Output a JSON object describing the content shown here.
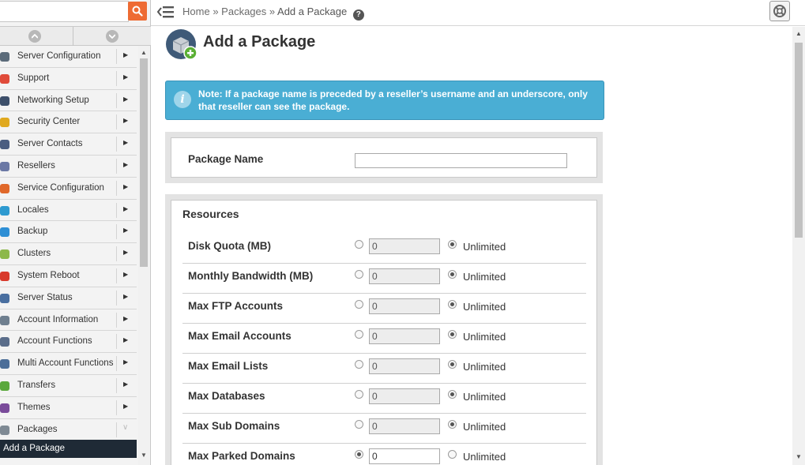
{
  "search": {
    "value": "",
    "placeholder": ""
  },
  "sidebar": {
    "items": [
      {
        "label": "Server Configuration",
        "icon": "server-config-icon",
        "color": "#5b6b7a"
      },
      {
        "label": "Support",
        "icon": "lifebuoy-icon",
        "color": "#e04b3a"
      },
      {
        "label": "Networking Setup",
        "icon": "network-icon",
        "color": "#3d4f6a"
      },
      {
        "label": "Security Center",
        "icon": "lock-icon",
        "color": "#e0a91f"
      },
      {
        "label": "Server Contacts",
        "icon": "contacts-icon",
        "color": "#4a5d80"
      },
      {
        "label": "Resellers",
        "icon": "resellers-icon",
        "color": "#6b78a5"
      },
      {
        "label": "Service Configuration",
        "icon": "wrench-icon",
        "color": "#e0682a"
      },
      {
        "label": "Locales",
        "icon": "globe-icon",
        "color": "#2e9ad0"
      },
      {
        "label": "Backup",
        "icon": "backup-icon",
        "color": "#2e8fd5"
      },
      {
        "label": "Clusters",
        "icon": "clusters-icon",
        "color": "#8db84a"
      },
      {
        "label": "System Reboot",
        "icon": "power-icon",
        "color": "#d83a2c"
      },
      {
        "label": "Server Status",
        "icon": "status-icon",
        "color": "#4a6fa0"
      },
      {
        "label": "Account Information",
        "icon": "account-info-icon",
        "color": "#6f7f8f"
      },
      {
        "label": "Account Functions",
        "icon": "account-functions-icon",
        "color": "#5a6d8a"
      },
      {
        "label": "Multi Account Functions",
        "icon": "multi-account-icon",
        "color": "#4c6e98"
      },
      {
        "label": "Transfers",
        "icon": "transfers-icon",
        "color": "#5aa83c"
      },
      {
        "label": "Themes",
        "icon": "themes-icon",
        "color": "#7a4b9a"
      },
      {
        "label": "Packages",
        "icon": "packages-icon",
        "color": "#7f8a94"
      }
    ],
    "active_item": "Add a Package"
  },
  "breadcrumb": {
    "home": "Home",
    "sep1": "»",
    "packages": "Packages",
    "sep2": "»",
    "current": "Add a Package",
    "help": "?"
  },
  "page": {
    "title": "Add a Package"
  },
  "note": {
    "text": "Note: If a package name is preceded by a reseller’s username and an underscore, only that reseller can see the package."
  },
  "package": {
    "label": "Package Name",
    "value": ""
  },
  "resources": {
    "title": "Resources",
    "unlimited_label": "Unlimited",
    "rows": [
      {
        "label": "Disk Quota (MB)",
        "value": "0",
        "unlimited": true
      },
      {
        "label": "Monthly Bandwidth (MB)",
        "value": "0",
        "unlimited": true
      },
      {
        "label": "Max FTP Accounts",
        "value": "0",
        "unlimited": true
      },
      {
        "label": "Max Email Accounts",
        "value": "0",
        "unlimited": true
      },
      {
        "label": "Max Email Lists",
        "value": "0",
        "unlimited": true
      },
      {
        "label": "Max Databases",
        "value": "0",
        "unlimited": true
      },
      {
        "label": "Max Sub Domains",
        "value": "0",
        "unlimited": true
      },
      {
        "label": "Max Parked Domains",
        "value": "0",
        "unlimited": false
      }
    ]
  },
  "colors": {
    "accent": "#ee6b33",
    "note_bg": "#4aaed4",
    "active_nav": "#1f2a36"
  }
}
